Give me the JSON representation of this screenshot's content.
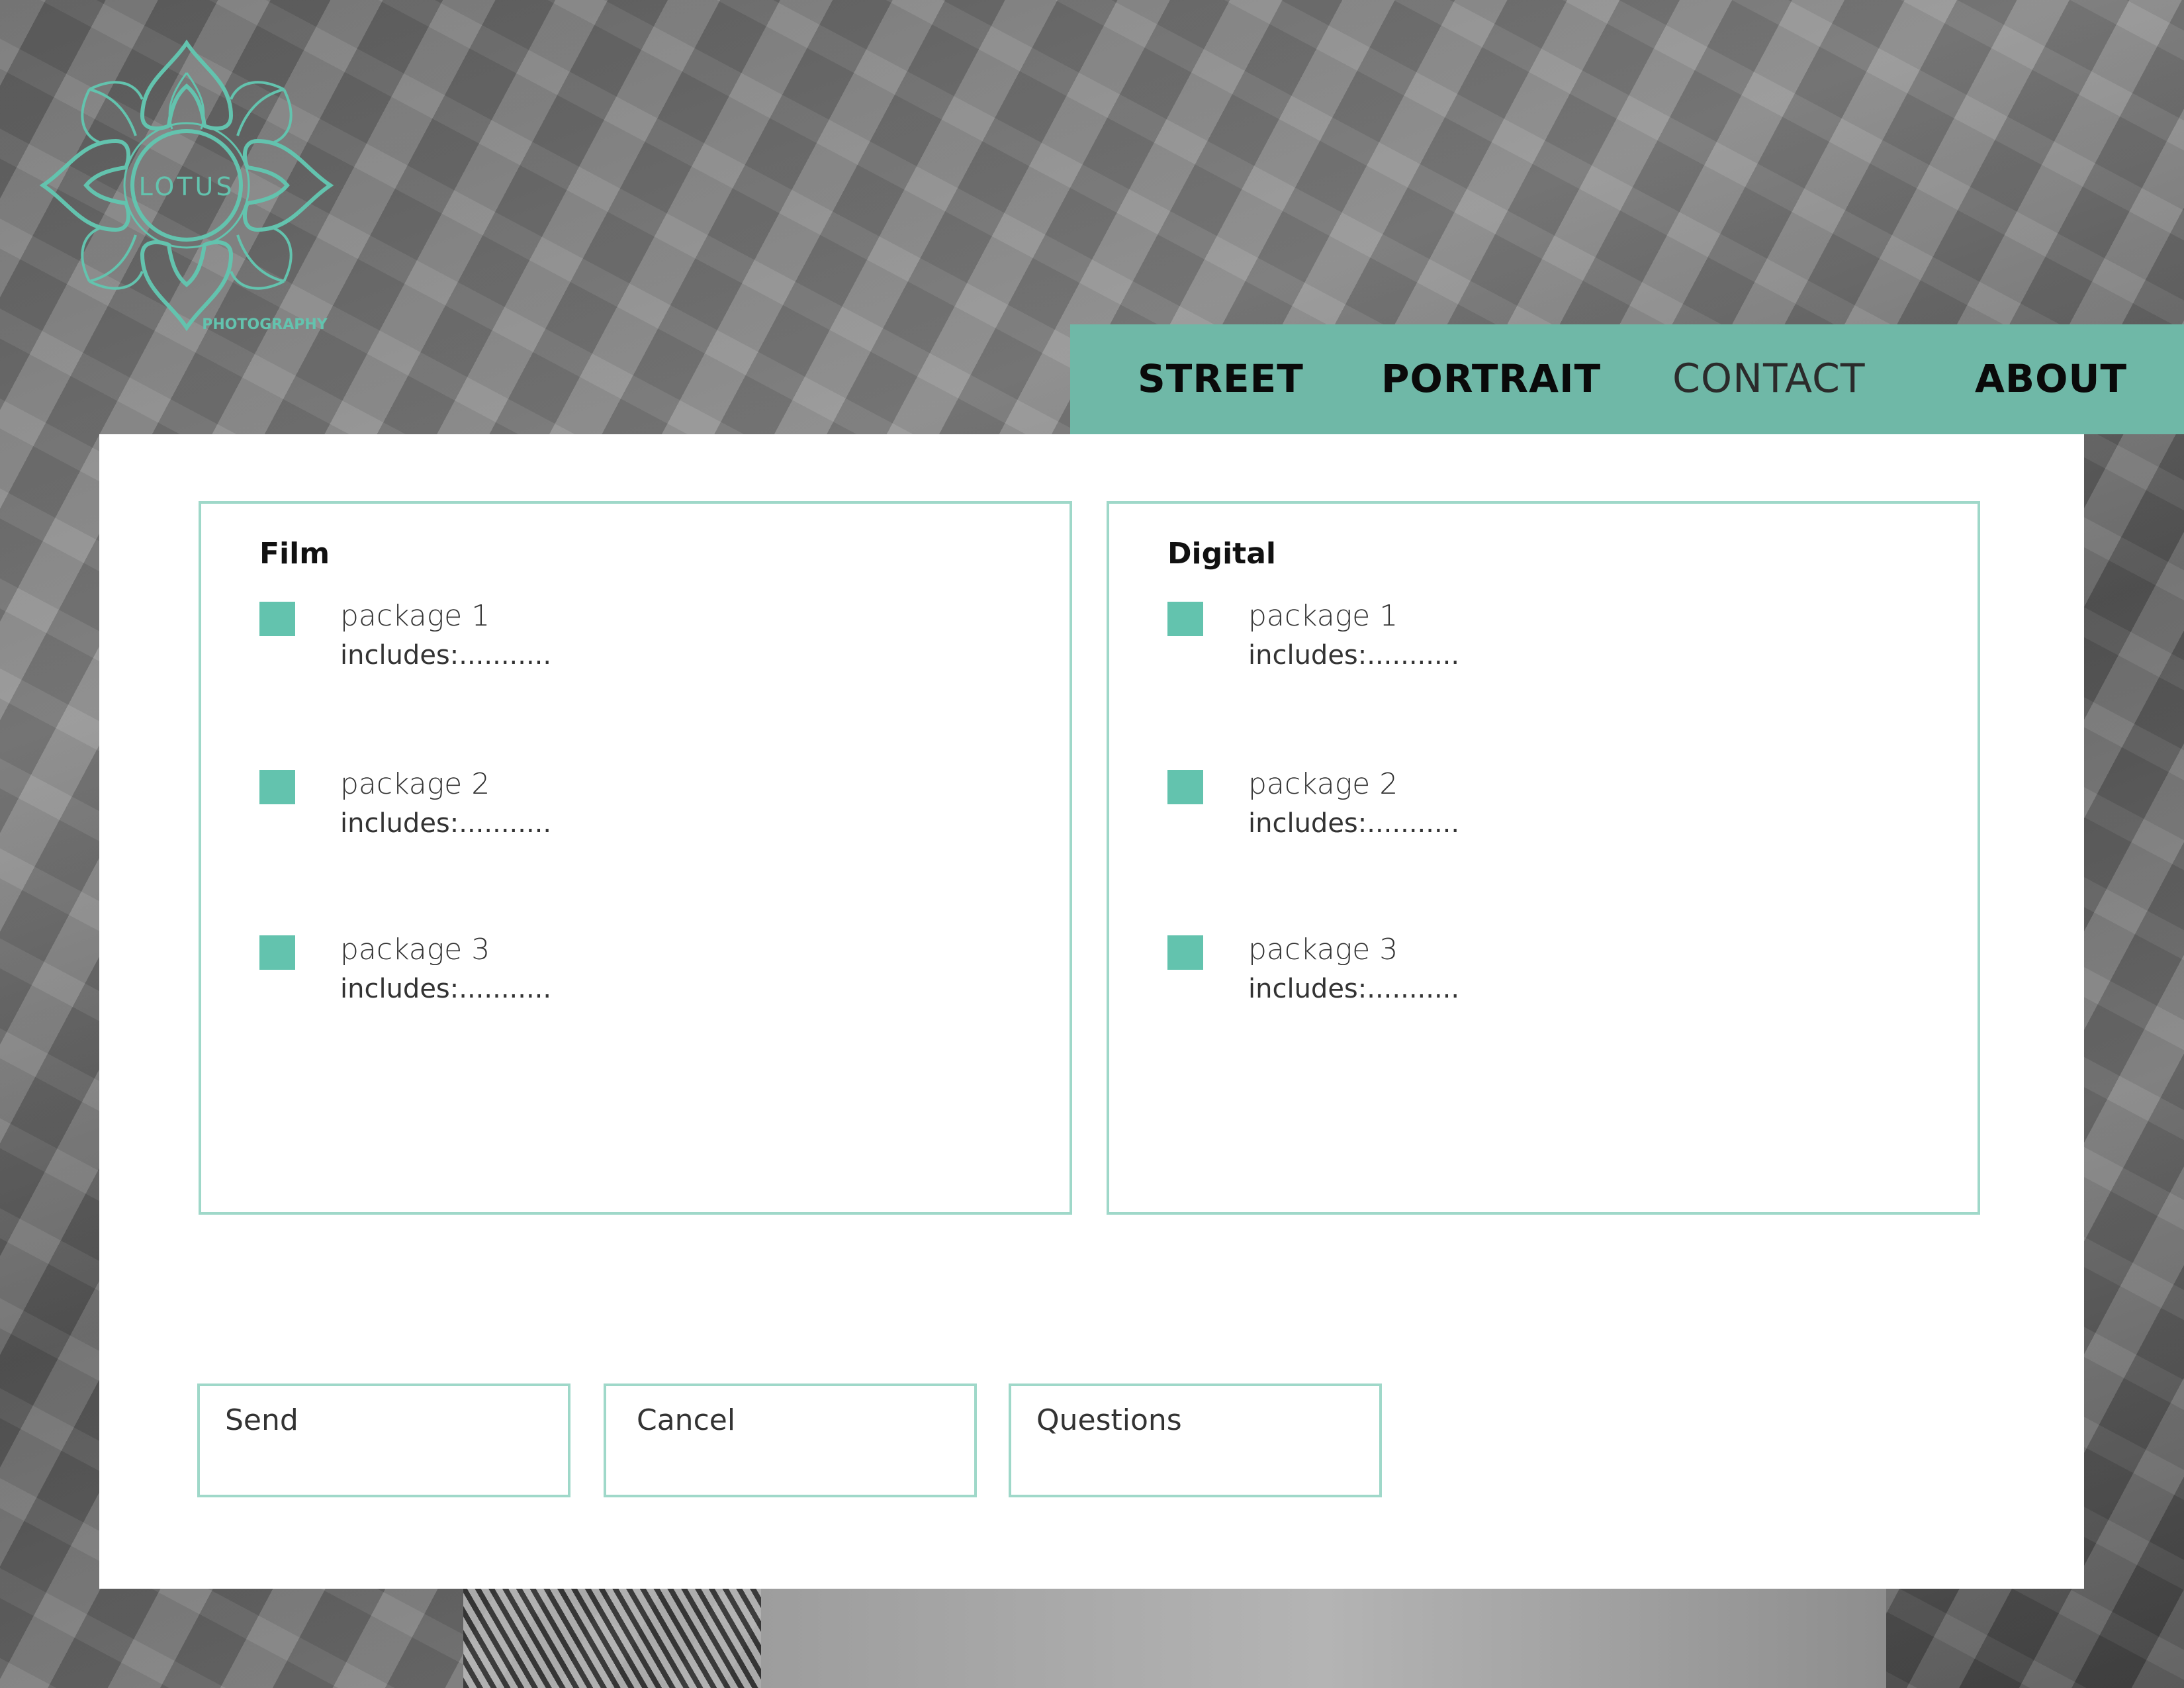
{
  "brand": {
    "name": "LOTUS",
    "tagline": "PHOTOGRAPHY",
    "color": "#63c3ae"
  },
  "nav": {
    "items": [
      {
        "label": "STREET"
      },
      {
        "label": "PORTRAIT"
      },
      {
        "label": "CONTACT"
      },
      {
        "label": "ABOUT"
      }
    ],
    "active": "CONTACT"
  },
  "film": {
    "title": "Film",
    "packages": [
      {
        "name": "package 1",
        "includes": "includes:..........."
      },
      {
        "name": "package 2",
        "includes": "includes:..........."
      },
      {
        "name": "package 3",
        "includes": "includes:..........."
      }
    ]
  },
  "digital": {
    "title": "Digital",
    "packages": [
      {
        "name": "package 1",
        "includes": "includes:..........."
      },
      {
        "name": "package 2",
        "includes": "includes:..........."
      },
      {
        "name": "package 3",
        "includes": "includes:..........."
      }
    ]
  },
  "actions": {
    "send": "Send",
    "cancel": "Cancel",
    "questions": "Questions"
  },
  "colors": {
    "accent": "#63c3ae",
    "border": "#9fd8c9",
    "nav_bg": "#6fb8a7"
  }
}
